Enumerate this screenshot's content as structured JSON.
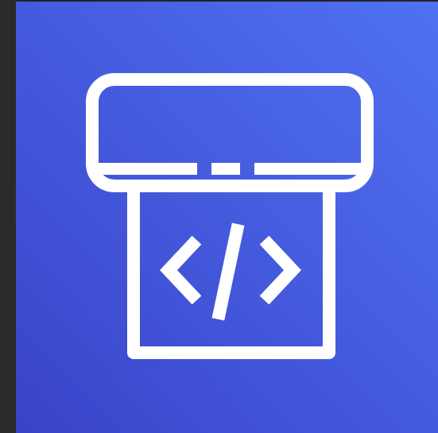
{
  "icon": {
    "name": "cloud-development-device-icon",
    "gradient_start": "#3A43C8",
    "gradient_end": "#4F72F2",
    "stroke": "#FFFFFF",
    "background": "#222222"
  }
}
